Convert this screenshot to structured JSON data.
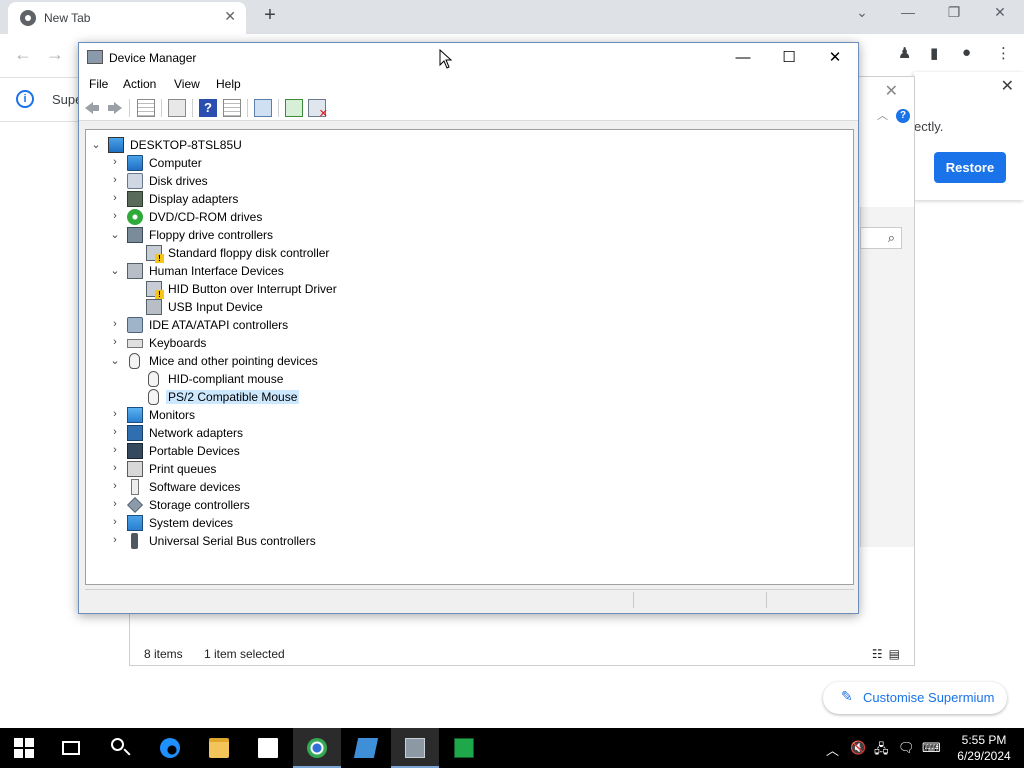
{
  "browser": {
    "tab_title": "New Tab",
    "tab_close": "✕",
    "new_tab": "+",
    "infobar_text": "Supe",
    "restore_panel": {
      "close": "✕",
      "message": "ectly.",
      "restore_label": "Restore"
    },
    "customise_label": "Customise Supermium",
    "bg_window": {
      "close": "✕",
      "help": "?",
      "status_items": "8 items",
      "status_selected": "1 item selected"
    }
  },
  "device_manager": {
    "title": "Device Manager",
    "menu": [
      "File",
      "Action",
      "View",
      "Help"
    ],
    "toolbar_help": "?",
    "tree": [
      {
        "label": "DESKTOP-8TSL85U",
        "level": 0,
        "expanded": true,
        "icon": "computer-root-icon"
      },
      {
        "label": "Computer",
        "level": 1,
        "expanded": false,
        "icon": "computer-icon"
      },
      {
        "label": "Disk drives",
        "level": 1,
        "expanded": false,
        "icon": "disk-drive-icon"
      },
      {
        "label": "Display adapters",
        "level": 1,
        "expanded": false,
        "icon": "display-adapter-icon"
      },
      {
        "label": "DVD/CD-ROM drives",
        "level": 1,
        "expanded": false,
        "icon": "dvd-drive-icon"
      },
      {
        "label": "Floppy drive controllers",
        "level": 1,
        "expanded": true,
        "icon": "floppy-controller-icon"
      },
      {
        "label": "Standard floppy disk controller",
        "level": 2,
        "icon": "warning-device-icon"
      },
      {
        "label": "Human Interface Devices",
        "level": 1,
        "expanded": true,
        "icon": "hid-icon"
      },
      {
        "label": "HID Button over Interrupt Driver",
        "level": 2,
        "icon": "warning-device-icon"
      },
      {
        "label": "USB Input Device",
        "level": 2,
        "icon": "hid-icon"
      },
      {
        "label": "IDE ATA/ATAPI controllers",
        "level": 1,
        "expanded": false,
        "icon": "ide-controller-icon"
      },
      {
        "label": "Keyboards",
        "level": 1,
        "expanded": false,
        "icon": "keyboard-icon"
      },
      {
        "label": "Mice and other pointing devices",
        "level": 1,
        "expanded": true,
        "icon": "mouse-icon"
      },
      {
        "label": "HID-compliant mouse",
        "level": 2,
        "icon": "mouse-icon"
      },
      {
        "label": "PS/2 Compatible Mouse",
        "level": 2,
        "icon": "mouse-icon",
        "selected": true
      },
      {
        "label": "Monitors",
        "level": 1,
        "expanded": false,
        "icon": "monitor-icon"
      },
      {
        "label": "Network adapters",
        "level": 1,
        "expanded": false,
        "icon": "network-adapter-icon"
      },
      {
        "label": "Portable Devices",
        "level": 1,
        "expanded": false,
        "icon": "portable-device-icon"
      },
      {
        "label": "Print queues",
        "level": 1,
        "expanded": false,
        "icon": "printer-icon"
      },
      {
        "label": "Software devices",
        "level": 1,
        "expanded": false,
        "icon": "software-device-icon"
      },
      {
        "label": "Storage controllers",
        "level": 1,
        "expanded": false,
        "icon": "storage-controller-icon"
      },
      {
        "label": "System devices",
        "level": 1,
        "expanded": false,
        "icon": "system-device-icon"
      },
      {
        "label": "Universal Serial Bus controllers",
        "level": 1,
        "expanded": false,
        "icon": "usb-controller-icon"
      }
    ]
  },
  "taskbar": {
    "apps": [
      "start-icon",
      "task-view-icon",
      "search-icon",
      "edge-icon",
      "file-explorer-icon",
      "store-icon",
      "chromium-icon",
      "app-icon",
      "device-manager-icon",
      "app-icon"
    ],
    "active_app": "device-manager-icon",
    "time": "5:55 PM",
    "date": "6/29/2024"
  },
  "colors": {
    "accent": "#1a73e8",
    "selection": "#cce8ff",
    "taskbar": "#000000"
  }
}
